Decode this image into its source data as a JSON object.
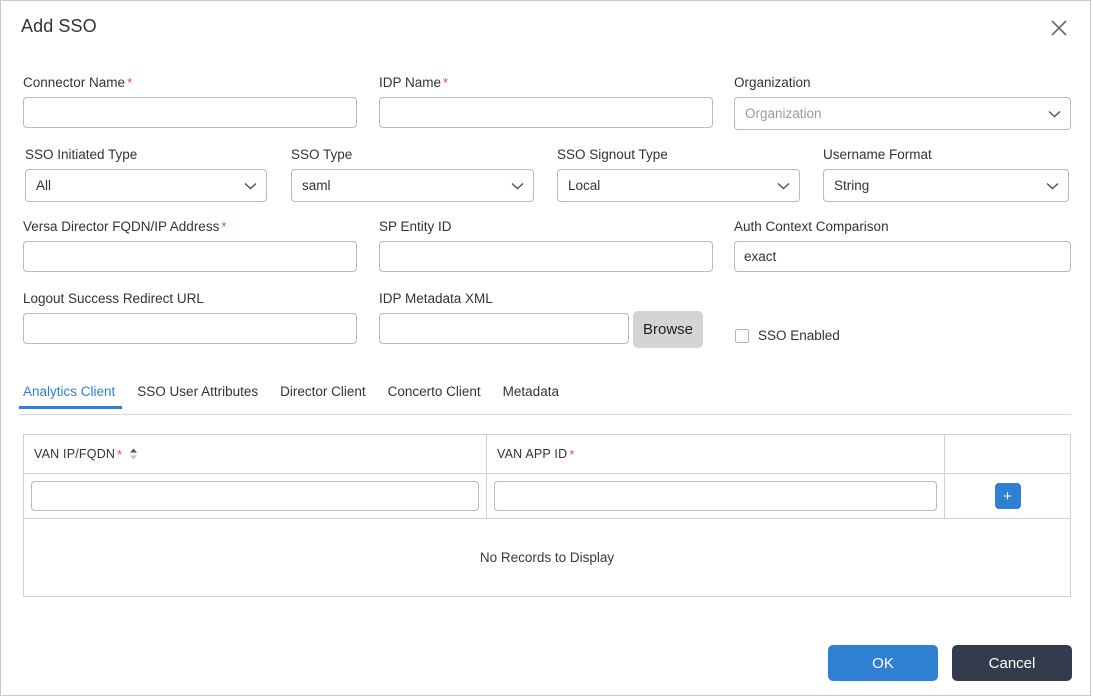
{
  "dialog": {
    "title": "Add SSO",
    "close_icon": "close-icon"
  },
  "fields": {
    "connector_name": {
      "label": "Connector Name",
      "required": "*",
      "value": "",
      "placeholder": ""
    },
    "idp_name": {
      "label": "IDP Name",
      "required": "*",
      "value": "",
      "placeholder": ""
    },
    "organization": {
      "label": "Organization",
      "value": "Organization"
    },
    "sso_initiated_type": {
      "label": "SSO Initiated Type",
      "value": "All"
    },
    "sso_type": {
      "label": "SSO Type",
      "value": "saml"
    },
    "sso_signout_type": {
      "label": "SSO Signout Type",
      "value": "Local"
    },
    "username_format": {
      "label": "Username Format",
      "value": "String"
    },
    "versa_director_fqdn": {
      "label": "Versa Director FQDN/IP Address",
      "required": "*",
      "value": "",
      "placeholder": ""
    },
    "sp_entity_id": {
      "label": "SP Entity ID",
      "value": "",
      "placeholder": ""
    },
    "auth_context_comparison": {
      "label": "Auth Context Comparison",
      "value": "exact",
      "placeholder": ""
    },
    "logout_success_redirect_url": {
      "label": "Logout Success Redirect URL",
      "value": "",
      "placeholder": ""
    },
    "idp_metadata_xml": {
      "label": "IDP Metadata XML",
      "value": "",
      "placeholder": ""
    },
    "browse_button": "Browse",
    "sso_enabled": {
      "label": "SSO Enabled",
      "checked": false
    }
  },
  "tabs": [
    {
      "label": "Analytics Client",
      "active": true
    },
    {
      "label": "SSO User Attributes",
      "active": false
    },
    {
      "label": "Director Client",
      "active": false
    },
    {
      "label": "Concerto Client",
      "active": false
    },
    {
      "label": "Metadata",
      "active": false
    }
  ],
  "table": {
    "columns": [
      {
        "label": "VAN IP/FQDN",
        "required": "*",
        "sortable": true,
        "sort_icon": "sort-arrows-icon"
      },
      {
        "label": "VAN APP ID",
        "required": "*",
        "sortable": false
      },
      {
        "label": ""
      }
    ],
    "new_row": {
      "van_ip_fqdn": "",
      "van_app_id": "",
      "add_button_label": "+"
    },
    "empty_message": "No Records to Display"
  },
  "footer": {
    "ok_label": "OK",
    "cancel_label": "Cancel"
  },
  "colors": {
    "accent_blue": "#2f80d2",
    "cancel_dark": "#333b4d",
    "required_red": "#e8445a",
    "browse_gray": "#d4d4d4"
  }
}
